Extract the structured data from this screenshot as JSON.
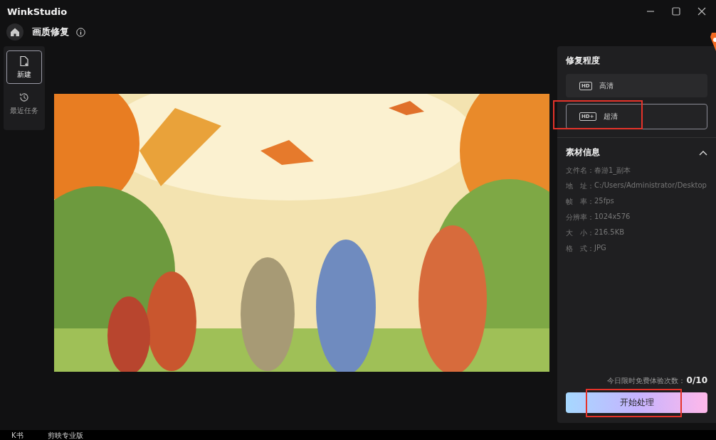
{
  "window": {
    "title": "WinkStudio"
  },
  "header": {
    "title": "画质修复"
  },
  "sidebar": {
    "items": [
      {
        "label": "新建",
        "selected": true
      },
      {
        "label": "最近任务",
        "selected": false
      }
    ]
  },
  "panel": {
    "quality_title": "修复程度",
    "quality_options": [
      {
        "badge": "HD",
        "label": "高清",
        "selected": false,
        "highlighted": false
      },
      {
        "badge": "HD+",
        "label": "超清",
        "selected": true,
        "highlighted": true
      }
    ],
    "info_title": "素材信息",
    "info_expanded": true,
    "info": [
      {
        "label": "文件名：",
        "value": "春游1_副本"
      },
      {
        "label": "地　址：",
        "value": "C:/Users/Administrator/Desktop"
      },
      {
        "label": "帧　率：",
        "value": "25fps"
      },
      {
        "label": "分辨率：",
        "value": "1024x576"
      },
      {
        "label": "大　小：",
        "value": "216.5KB"
      },
      {
        "label": "格　式：",
        "value": "JPG"
      }
    ],
    "quota_label": "今日限时免费体验次数：",
    "quota_value": "0/10",
    "start_button": {
      "label": "开始处理",
      "highlighted": true
    }
  },
  "taskbar": {
    "items": [
      "K书",
      "剪映专业版"
    ]
  }
}
